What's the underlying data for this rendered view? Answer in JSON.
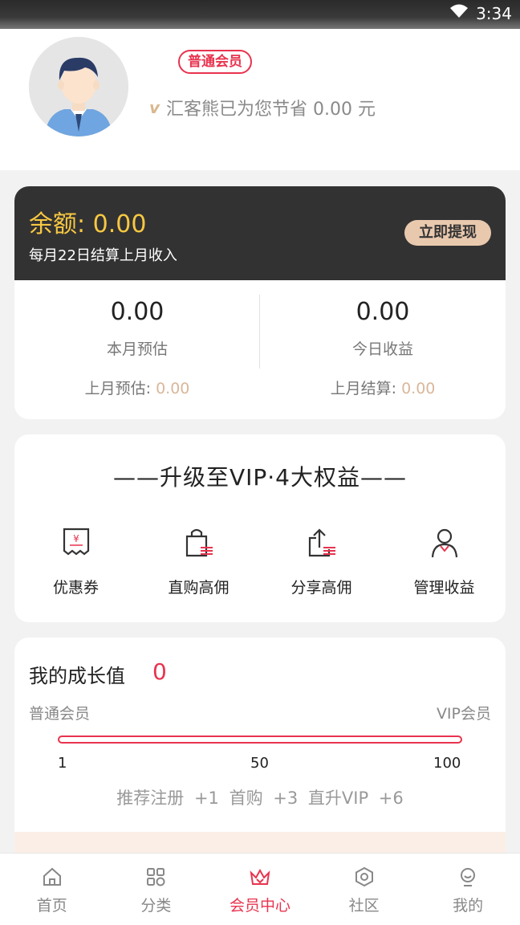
{
  "status_bar": {
    "time": "3:34"
  },
  "profile": {
    "member_level": "普通会员",
    "savings_text": "汇客熊已为您节省 0.00 元",
    "v_mark": "v"
  },
  "balance": {
    "amount_text": "余额: 0.00",
    "settle_note": "每月22日结算上月收入",
    "withdraw_label": "立即提现",
    "month_estimate": {
      "value": "0.00",
      "label": "本月预估",
      "sub_label": "上月预估: ",
      "sub_value": "0.00"
    },
    "today_income": {
      "value": "0.00",
      "label": "今日收益",
      "sub_label": "上月结算: ",
      "sub_value": "0.00"
    }
  },
  "vip": {
    "title": "——升级至VIP·4大权益——",
    "benefits": [
      {
        "label": "优惠券",
        "icon": "coupon-icon"
      },
      {
        "label": "直购高佣",
        "icon": "shopping-bag-icon"
      },
      {
        "label": "分享高佣",
        "icon": "share-icon"
      },
      {
        "label": "管理收益",
        "icon": "user-icon"
      }
    ]
  },
  "growth": {
    "title": "我的成长值",
    "value": "0",
    "level_from": "普通会员",
    "level_to": "VIP会员",
    "progress": 0,
    "ticks": [
      "1",
      "50",
      "100"
    ],
    "rules_text": "推荐注册 +1  首购 +3  直升VIP +6"
  },
  "tabbar": {
    "items": [
      {
        "label": "首页",
        "icon": "home-icon",
        "active": false
      },
      {
        "label": "分类",
        "icon": "category-icon",
        "active": false
      },
      {
        "label": "会员中心",
        "icon": "crown-icon",
        "active": true
      },
      {
        "label": "社区",
        "icon": "community-icon",
        "active": false
      },
      {
        "label": "我的",
        "icon": "profile-icon",
        "active": false
      }
    ]
  },
  "colors": {
    "accent": "#e8334e",
    "gold": "#f7c842",
    "dark_header": "#333232",
    "beige": "#e9c9ae"
  }
}
